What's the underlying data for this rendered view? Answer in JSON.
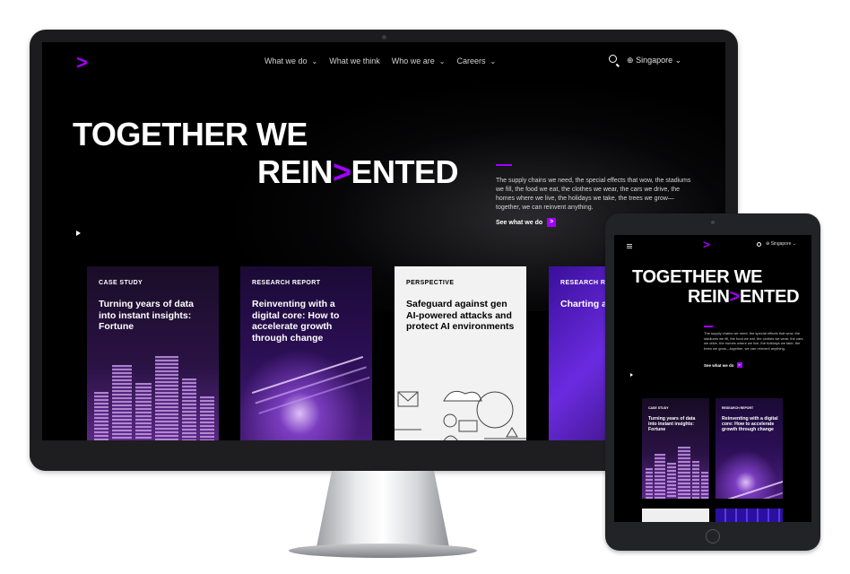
{
  "brand": {
    "accent": "#a100ff",
    "logo_glyph": ">"
  },
  "desktop": {
    "nav": [
      {
        "label": "What we do",
        "has_caret": true
      },
      {
        "label": "What we think",
        "has_caret": false
      },
      {
        "label": "Who we are",
        "has_caret": true
      },
      {
        "label": "Careers",
        "has_caret": true
      }
    ],
    "locale": "Singapore",
    "caret": "⌄",
    "hero": {
      "line1": "TOGETHER WE",
      "line2_start": "REIN",
      "line2_chevron": ">",
      "line2_end": "ENTED",
      "description": "The supply chains we need, the special effects that wow, the stadiums we fill, the food we eat, the clothes we wear, the cars we drive, the homes where we live, the holidays we take, the trees we grow—together, we can reinvent anything.",
      "cta": "See what we do",
      "cta_arrow": ">"
    },
    "cards": [
      {
        "tag": "CASE STUDY",
        "title": "Turning years of data into instant insights: Fortune"
      },
      {
        "tag": "RESEARCH REPORT",
        "title": "Reinventing with a digital core: How to accelerate growth through change"
      },
      {
        "tag": "PERSPECTIVE",
        "title": "Safeguard against gen AI-powered attacks and protect AI environments"
      },
      {
        "tag": "RESEARCH RE",
        "title": "Charting a to reinvent"
      }
    ]
  },
  "tablet": {
    "locale": "Singapore",
    "hero": {
      "line1": "TOGETHER WE",
      "line2_start": "REIN",
      "line2_chevron": ">",
      "line2_end": "ENTED",
      "description": "The supply chains we need, the special effects that wow, the stadiums we fill, the food we eat, the clothes we wear, the cars we drive, the homes where we live, the holidays we take, the trees we grow—together, we can reinvent anything.",
      "cta": "See what we do",
      "cta_arrow": ">"
    },
    "cards": [
      {
        "tag": "CASE STUDY",
        "title": "Turning years of data into instant insights: Fortune"
      },
      {
        "tag": "RESEARCH REPORT",
        "title": "Reinventing with a digital core: How to accelerate growth through change"
      }
    ]
  },
  "icons": [
    "search-icon",
    "globe-icon",
    "chevron-down-icon",
    "play-icon",
    "menu-icon",
    "arrow-right-icon"
  ]
}
